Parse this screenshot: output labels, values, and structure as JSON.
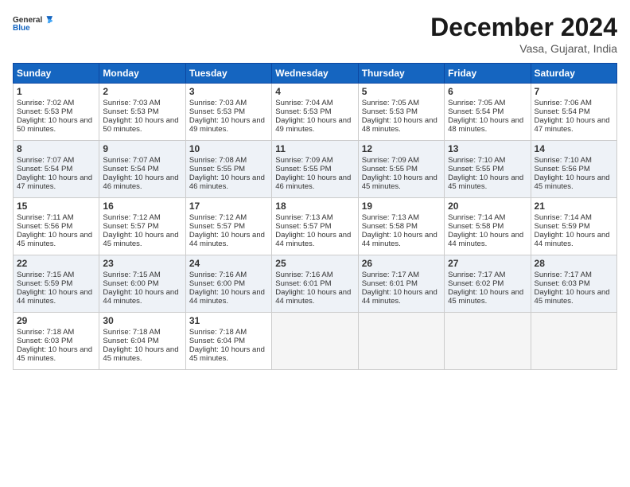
{
  "logo": {
    "general": "General",
    "blue": "Blue"
  },
  "title": "December 2024",
  "location": "Vasa, Gujarat, India",
  "days_of_week": [
    "Sunday",
    "Monday",
    "Tuesday",
    "Wednesday",
    "Thursday",
    "Friday",
    "Saturday"
  ],
  "weeks": [
    [
      {
        "day": "1",
        "sunrise": "Sunrise: 7:02 AM",
        "sunset": "Sunset: 5:53 PM",
        "daylight": "Daylight: 10 hours and 50 minutes."
      },
      {
        "day": "2",
        "sunrise": "Sunrise: 7:03 AM",
        "sunset": "Sunset: 5:53 PM",
        "daylight": "Daylight: 10 hours and 50 minutes."
      },
      {
        "day": "3",
        "sunrise": "Sunrise: 7:03 AM",
        "sunset": "Sunset: 5:53 PM",
        "daylight": "Daylight: 10 hours and 49 minutes."
      },
      {
        "day": "4",
        "sunrise": "Sunrise: 7:04 AM",
        "sunset": "Sunset: 5:53 PM",
        "daylight": "Daylight: 10 hours and 49 minutes."
      },
      {
        "day": "5",
        "sunrise": "Sunrise: 7:05 AM",
        "sunset": "Sunset: 5:53 PM",
        "daylight": "Daylight: 10 hours and 48 minutes."
      },
      {
        "day": "6",
        "sunrise": "Sunrise: 7:05 AM",
        "sunset": "Sunset: 5:54 PM",
        "daylight": "Daylight: 10 hours and 48 minutes."
      },
      {
        "day": "7",
        "sunrise": "Sunrise: 7:06 AM",
        "sunset": "Sunset: 5:54 PM",
        "daylight": "Daylight: 10 hours and 47 minutes."
      }
    ],
    [
      {
        "day": "8",
        "sunrise": "Sunrise: 7:07 AM",
        "sunset": "Sunset: 5:54 PM",
        "daylight": "Daylight: 10 hours and 47 minutes."
      },
      {
        "day": "9",
        "sunrise": "Sunrise: 7:07 AM",
        "sunset": "Sunset: 5:54 PM",
        "daylight": "Daylight: 10 hours and 46 minutes."
      },
      {
        "day": "10",
        "sunrise": "Sunrise: 7:08 AM",
        "sunset": "Sunset: 5:55 PM",
        "daylight": "Daylight: 10 hours and 46 minutes."
      },
      {
        "day": "11",
        "sunrise": "Sunrise: 7:09 AM",
        "sunset": "Sunset: 5:55 PM",
        "daylight": "Daylight: 10 hours and 46 minutes."
      },
      {
        "day": "12",
        "sunrise": "Sunrise: 7:09 AM",
        "sunset": "Sunset: 5:55 PM",
        "daylight": "Daylight: 10 hours and 45 minutes."
      },
      {
        "day": "13",
        "sunrise": "Sunrise: 7:10 AM",
        "sunset": "Sunset: 5:55 PM",
        "daylight": "Daylight: 10 hours and 45 minutes."
      },
      {
        "day": "14",
        "sunrise": "Sunrise: 7:10 AM",
        "sunset": "Sunset: 5:56 PM",
        "daylight": "Daylight: 10 hours and 45 minutes."
      }
    ],
    [
      {
        "day": "15",
        "sunrise": "Sunrise: 7:11 AM",
        "sunset": "Sunset: 5:56 PM",
        "daylight": "Daylight: 10 hours and 45 minutes."
      },
      {
        "day": "16",
        "sunrise": "Sunrise: 7:12 AM",
        "sunset": "Sunset: 5:57 PM",
        "daylight": "Daylight: 10 hours and 45 minutes."
      },
      {
        "day": "17",
        "sunrise": "Sunrise: 7:12 AM",
        "sunset": "Sunset: 5:57 PM",
        "daylight": "Daylight: 10 hours and 44 minutes."
      },
      {
        "day": "18",
        "sunrise": "Sunrise: 7:13 AM",
        "sunset": "Sunset: 5:57 PM",
        "daylight": "Daylight: 10 hours and 44 minutes."
      },
      {
        "day": "19",
        "sunrise": "Sunrise: 7:13 AM",
        "sunset": "Sunset: 5:58 PM",
        "daylight": "Daylight: 10 hours and 44 minutes."
      },
      {
        "day": "20",
        "sunrise": "Sunrise: 7:14 AM",
        "sunset": "Sunset: 5:58 PM",
        "daylight": "Daylight: 10 hours and 44 minutes."
      },
      {
        "day": "21",
        "sunrise": "Sunrise: 7:14 AM",
        "sunset": "Sunset: 5:59 PM",
        "daylight": "Daylight: 10 hours and 44 minutes."
      }
    ],
    [
      {
        "day": "22",
        "sunrise": "Sunrise: 7:15 AM",
        "sunset": "Sunset: 5:59 PM",
        "daylight": "Daylight: 10 hours and 44 minutes."
      },
      {
        "day": "23",
        "sunrise": "Sunrise: 7:15 AM",
        "sunset": "Sunset: 6:00 PM",
        "daylight": "Daylight: 10 hours and 44 minutes."
      },
      {
        "day": "24",
        "sunrise": "Sunrise: 7:16 AM",
        "sunset": "Sunset: 6:00 PM",
        "daylight": "Daylight: 10 hours and 44 minutes."
      },
      {
        "day": "25",
        "sunrise": "Sunrise: 7:16 AM",
        "sunset": "Sunset: 6:01 PM",
        "daylight": "Daylight: 10 hours and 44 minutes."
      },
      {
        "day": "26",
        "sunrise": "Sunrise: 7:17 AM",
        "sunset": "Sunset: 6:01 PM",
        "daylight": "Daylight: 10 hours and 44 minutes."
      },
      {
        "day": "27",
        "sunrise": "Sunrise: 7:17 AM",
        "sunset": "Sunset: 6:02 PM",
        "daylight": "Daylight: 10 hours and 45 minutes."
      },
      {
        "day": "28",
        "sunrise": "Sunrise: 7:17 AM",
        "sunset": "Sunset: 6:03 PM",
        "daylight": "Daylight: 10 hours and 45 minutes."
      }
    ],
    [
      {
        "day": "29",
        "sunrise": "Sunrise: 7:18 AM",
        "sunset": "Sunset: 6:03 PM",
        "daylight": "Daylight: 10 hours and 45 minutes."
      },
      {
        "day": "30",
        "sunrise": "Sunrise: 7:18 AM",
        "sunset": "Sunset: 6:04 PM",
        "daylight": "Daylight: 10 hours and 45 minutes."
      },
      {
        "day": "31",
        "sunrise": "Sunrise: 7:18 AM",
        "sunset": "Sunset: 6:04 PM",
        "daylight": "Daylight: 10 hours and 45 minutes."
      },
      null,
      null,
      null,
      null
    ]
  ]
}
